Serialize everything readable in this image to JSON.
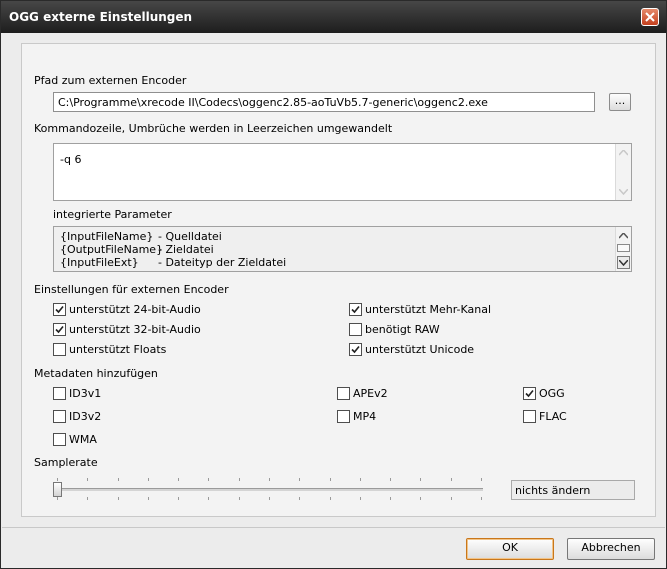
{
  "window": {
    "title": "OGG externe Einstellungen"
  },
  "encoder_path": {
    "label": "Pfad zum externen Encoder",
    "value": "C:\\Programme\\xrecode II\\Codecs\\oggenc2.85-aoTuVb5.7-generic\\oggenc2.exe",
    "browse_label": "..."
  },
  "command_line": {
    "label": "Kommandozeile, Umbrüche werden in Leerzeichen umgewandelt",
    "value": "-q 6"
  },
  "params": {
    "label": "integrierte Parameter",
    "rows": [
      {
        "name": "{InputFileName}",
        "desc": "- Quelldatei"
      },
      {
        "name": "{OutputFileName}",
        "desc": "- Zieldatei"
      },
      {
        "name": "{InputFileExt}",
        "desc": "- Dateityp der Zieldatei"
      }
    ]
  },
  "encoder_settings": {
    "label": "Einstellungen für externen Encoder",
    "items": [
      {
        "label": "unterstützt 24-bit-Audio",
        "checked": true
      },
      {
        "label": "unterstützt Mehr-Kanal",
        "checked": true
      },
      {
        "label": "unterstützt 32-bit-Audio",
        "checked": true
      },
      {
        "label": "benötigt RAW",
        "checked": false
      },
      {
        "label": "unterstützt Floats",
        "checked": false
      },
      {
        "label": "unterstützt Unicode",
        "checked": true
      }
    ]
  },
  "metadata": {
    "label": "Metadaten hinzufügen",
    "items": [
      {
        "label": "ID3v1",
        "checked": false
      },
      {
        "label": "APEv2",
        "checked": false
      },
      {
        "label": "OGG",
        "checked": true
      },
      {
        "label": "ID3v2",
        "checked": false
      },
      {
        "label": "MP4",
        "checked": false
      },
      {
        "label": "FLAC",
        "checked": false
      },
      {
        "label": "WMA",
        "checked": false
      }
    ]
  },
  "samplerate": {
    "label": "Samplerate",
    "value_text": "nichts ändern",
    "slider_position": 0
  },
  "buttons": {
    "ok": "OK",
    "cancel": "Abbrechen"
  },
  "colors": {
    "titlebar": "#2d2d2d",
    "close": "#d55a36",
    "default_button_border": "#c9771b"
  }
}
